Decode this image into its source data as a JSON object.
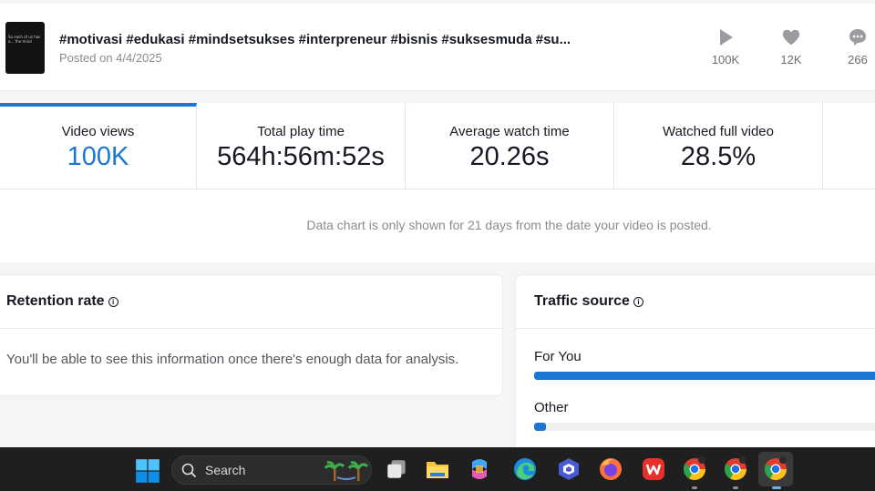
{
  "video": {
    "thumbnail_text": "So each of us has a… the mind",
    "title": "#motivasi #edukasi #mindsetsukses #interpreneur #bisnis #suksesmuda #su...",
    "posted": "Posted on 4/4/2025",
    "stats": [
      {
        "icon": "play-icon",
        "value": "100K"
      },
      {
        "icon": "heart-icon",
        "value": "12K"
      },
      {
        "icon": "comment-icon",
        "value": "266"
      }
    ]
  },
  "metrics": [
    {
      "label": "Video views",
      "value": "100K",
      "active": true
    },
    {
      "label": "Total play time",
      "value": "564h:56m:52s"
    },
    {
      "label": "Average watch time",
      "value": "20.26s"
    },
    {
      "label": "Watched full video",
      "value": "28.5%"
    }
  ],
  "chart_notice": "Data chart is only shown for 21 days from the date your video is posted.",
  "retention": {
    "title": "Retention rate",
    "message": "You'll be able to see this information once there's enough data for analysis."
  },
  "traffic": {
    "title": "Traffic source",
    "sources": [
      {
        "label": "For You",
        "share": 1.0
      },
      {
        "label": "Other",
        "share": 0.035
      }
    ]
  },
  "taskbar": {
    "search_label": "Search",
    "apps": [
      "windows-start-icon",
      "task-view-icon",
      "file-explorer-icon",
      "copilot-icon",
      "edge-icon",
      "app-icon",
      "firefox-icon",
      "wps-office-icon",
      "chrome-icon",
      "chrome-icon",
      "chrome-icon"
    ]
  },
  "colors": {
    "accent": "#1a77d4",
    "taskbar": "#1f1f1f"
  }
}
